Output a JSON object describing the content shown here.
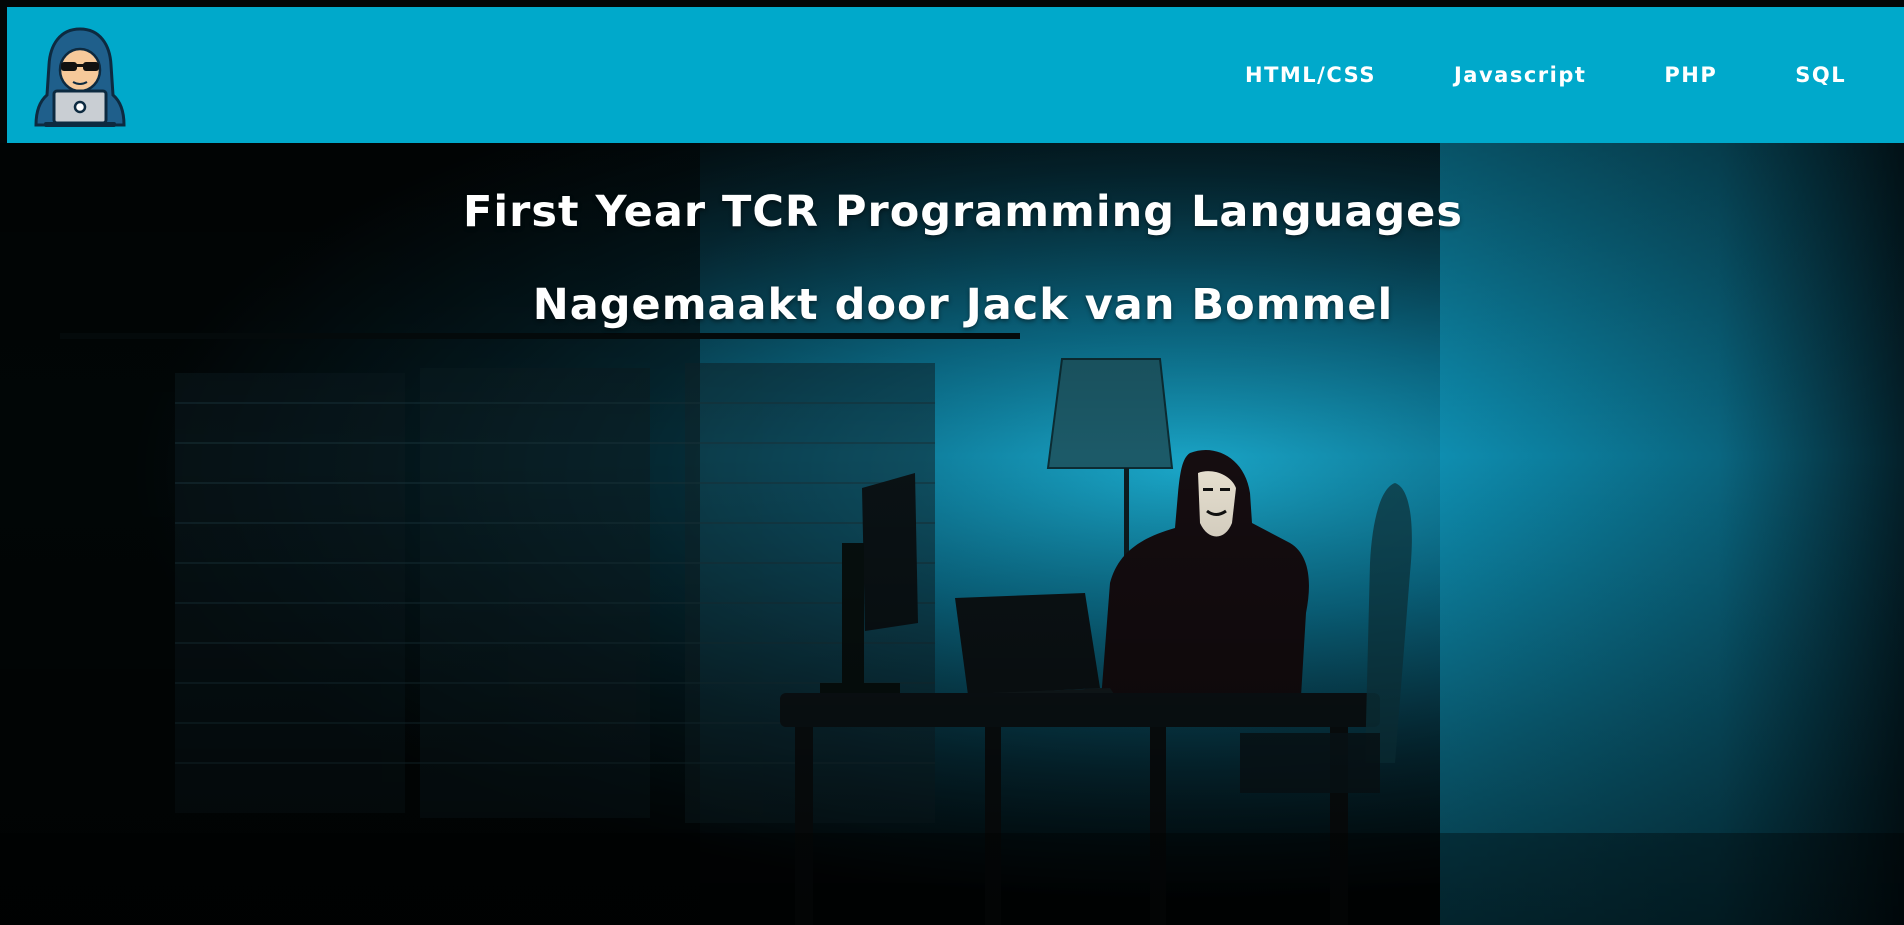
{
  "navbar": {
    "logo_icon": "hacker-laptop-icon",
    "links": [
      {
        "label": "HTML/CSS"
      },
      {
        "label": "Javascript"
      },
      {
        "label": "PHP"
      },
      {
        "label": "SQL"
      }
    ]
  },
  "hero": {
    "title": "First Year TCR Programming Languages",
    "subtitle": "Nagemaakt door Jack van Bommel"
  },
  "colors": {
    "navbar_bg": "#00a9cb",
    "text": "#ffffff",
    "scene_glow": "#0a8fb0"
  }
}
